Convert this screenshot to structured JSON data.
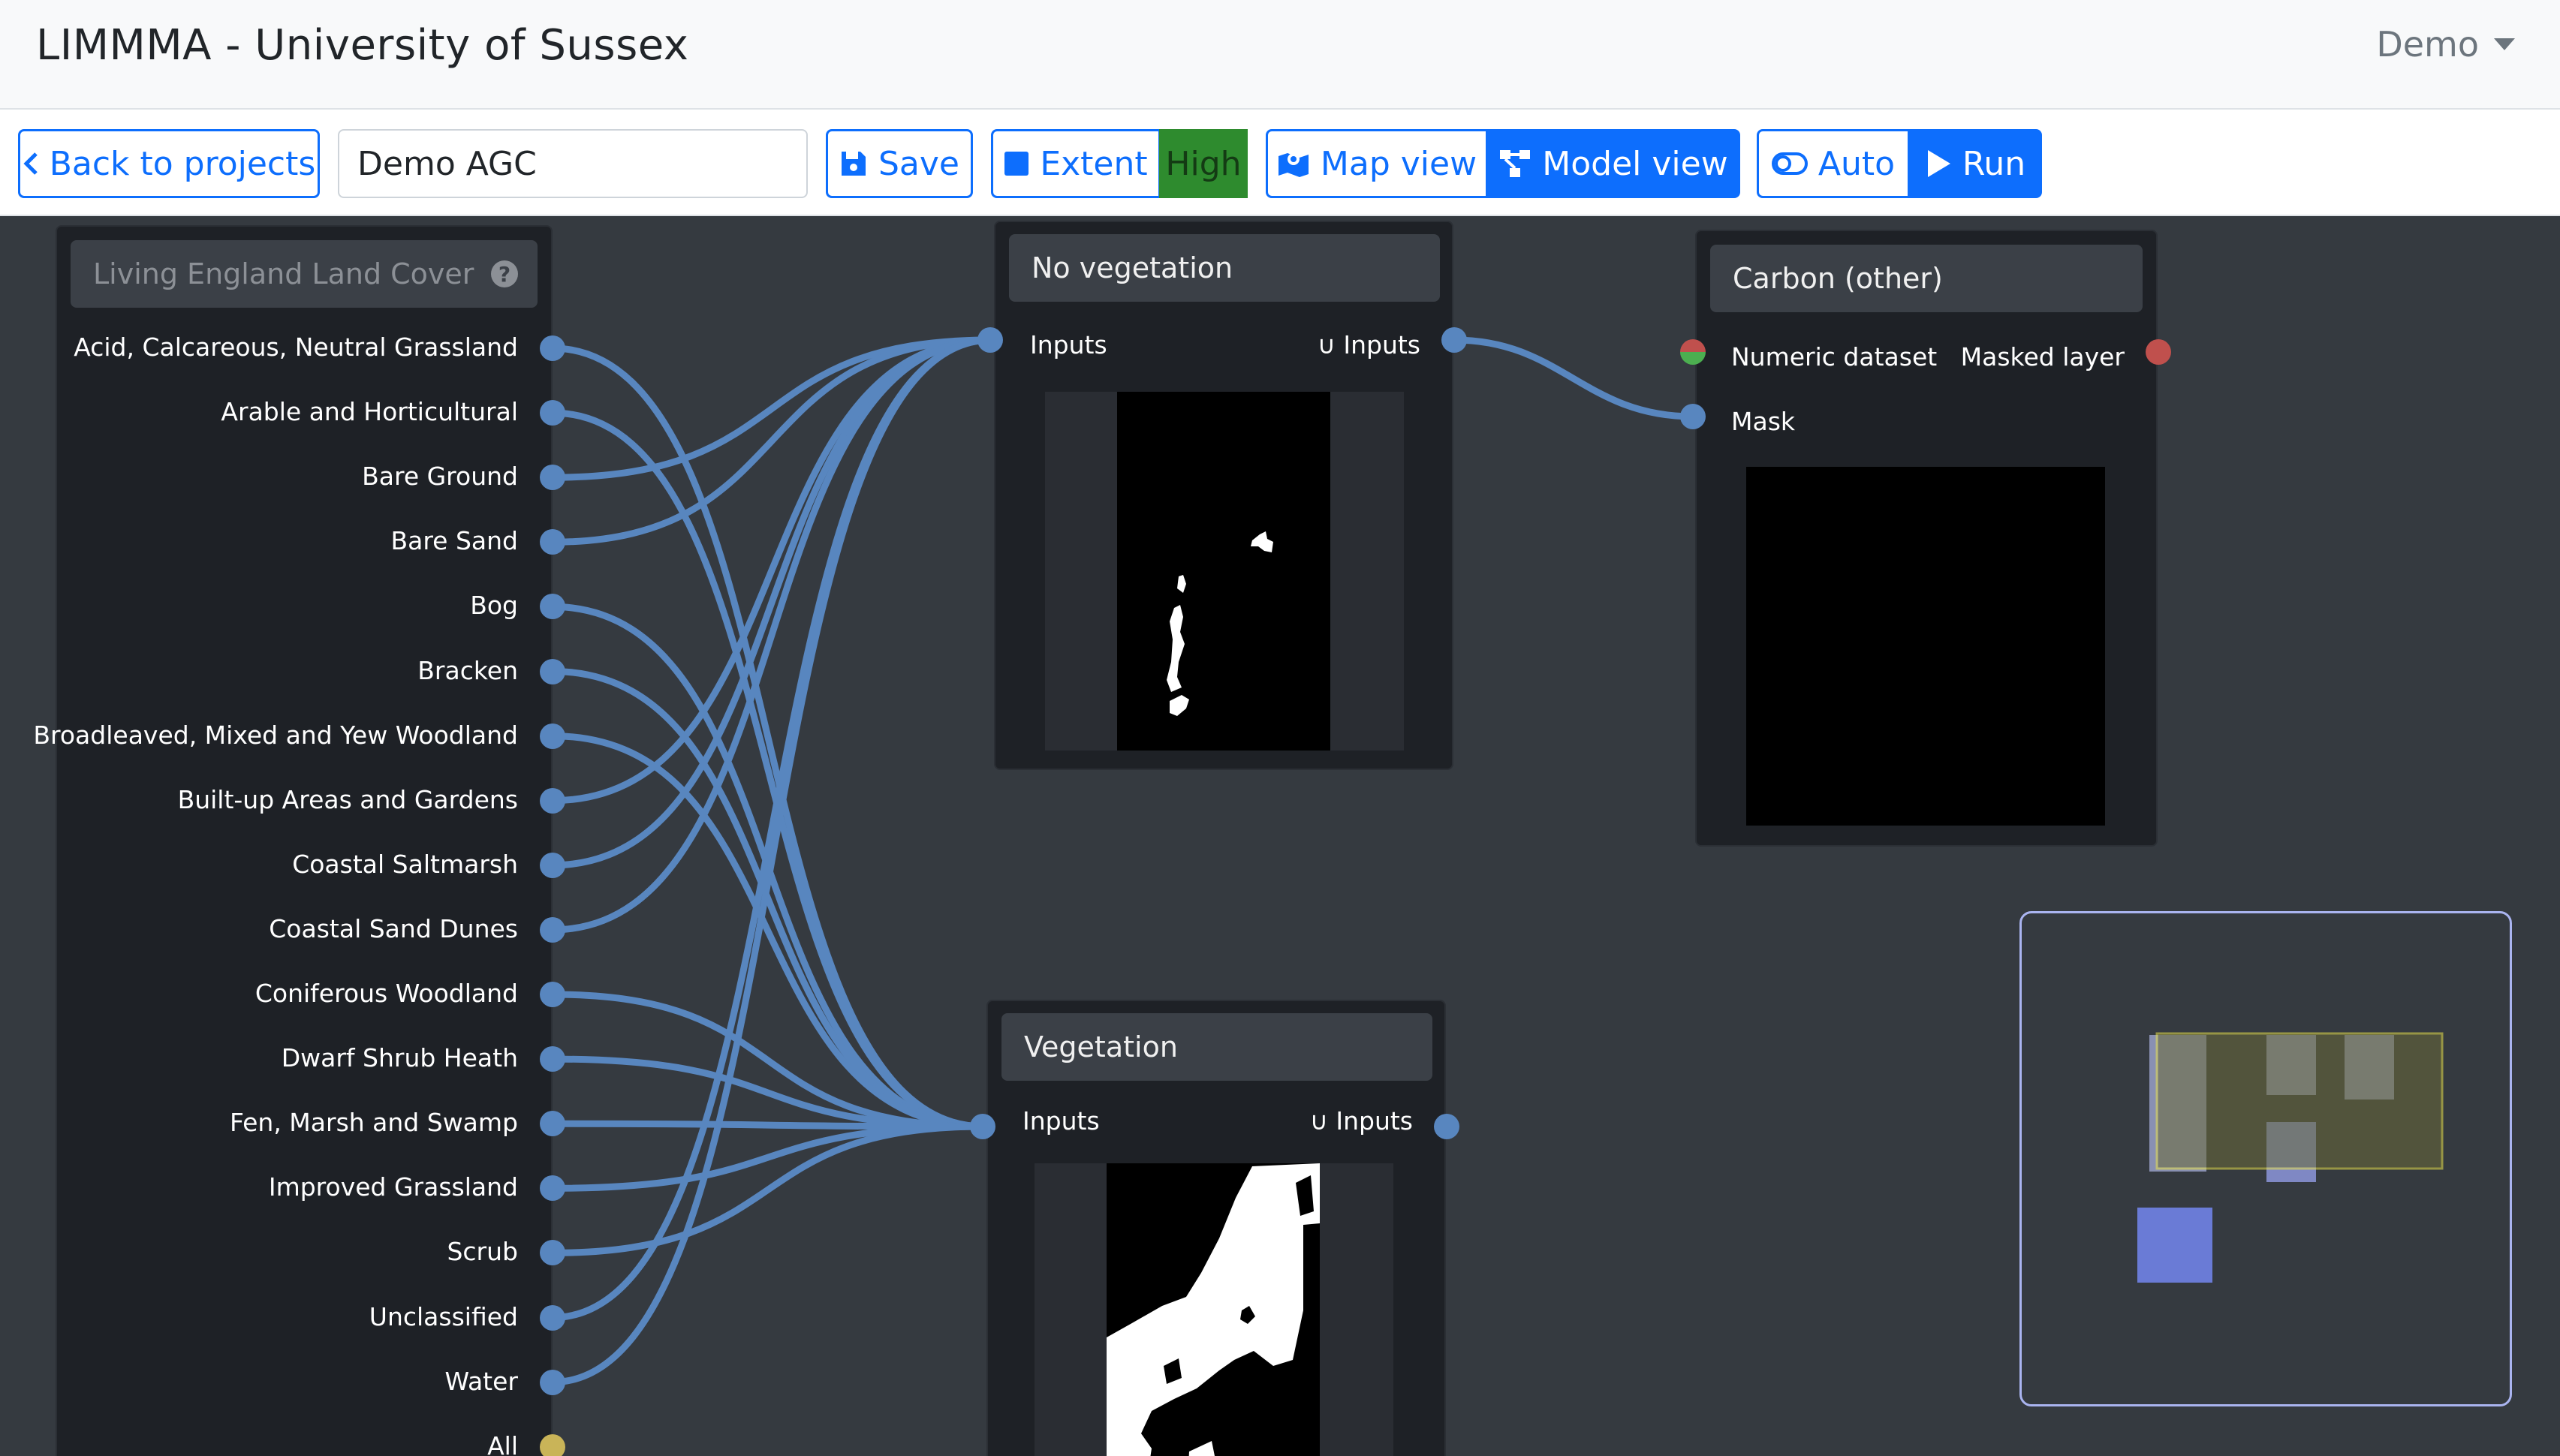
{
  "header": {
    "title": "LIMMMA - University of Sussex",
    "user_menu": "Demo"
  },
  "toolbar": {
    "back_label": "Back to projects",
    "project_name": "Demo AGC",
    "project_name_placeholder": "Project name",
    "save_label": "Save",
    "extent_label": "Extent",
    "quality_badge": "High",
    "map_view_label": "Map view",
    "model_view_label": "Model view",
    "auto_label": "Auto",
    "run_label": "Run"
  },
  "land_cover_node": {
    "title": "Living England Land Cover",
    "outputs": [
      "Acid, Calcareous, Neutral Grassland",
      "Arable and Horticultural",
      "Bare Ground",
      "Bare Sand",
      "Bog",
      "Bracken",
      "Broadleaved, Mixed and Yew Woodland",
      "Built-up Areas and Gardens",
      "Coastal Saltmarsh",
      "Coastal Sand Dunes",
      "Coniferous Woodland",
      "Dwarf Shrub Heath",
      "Fen, Marsh and Swamp",
      "Improved Grassland",
      "Scrub",
      "Unclassified",
      "Water",
      "All"
    ]
  },
  "no_vegetation_node": {
    "title": "No vegetation",
    "input_label": "Inputs",
    "output_label": "∪ Inputs"
  },
  "vegetation_node": {
    "title": "Vegetation",
    "input_label": "Inputs",
    "output_label": "∪ Inputs"
  },
  "carbon_node": {
    "title": "Carbon (other)",
    "input_numeric_label": "Numeric dataset",
    "input_mask_label": "Mask",
    "output_label": "Masked layer"
  },
  "colors": {
    "primary": "#0d6efd",
    "port": "#5886bf",
    "canvas": "#353a40",
    "node": "#1e2126",
    "badge_high": "#2e8b2e",
    "port_all": "#c9b458",
    "port_error": "#c0504d",
    "port_numeric_top": "#c0504d",
    "port_numeric_bottom": "#4caf50"
  }
}
